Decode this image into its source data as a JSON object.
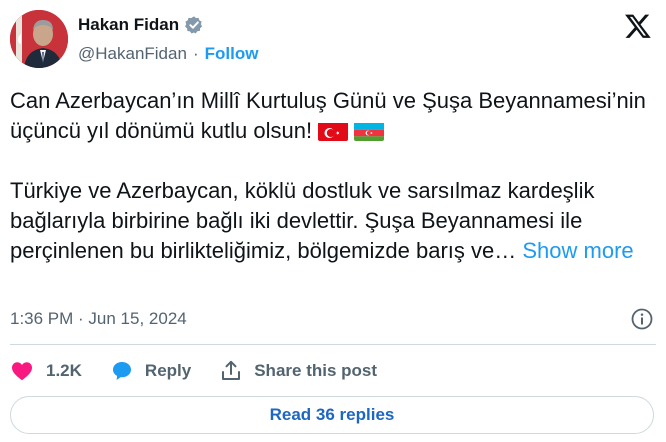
{
  "author": {
    "display_name": "Hakan Fidan",
    "handle": "@HakanFidan",
    "separator": "·",
    "follow_label": "Follow",
    "verified": true
  },
  "tweet": {
    "paragraph1": "Can Azerbaycan’ın Millî Kurtuluş Günü ve Şuşa Beyannamesi’nin üçüncü yıl dönümü kutlu olsun!",
    "paragraph2": "Türkiye ve Azerbaycan, köklü dostluk ve sarsılmaz kardeşlik bağlarıyla birbirine bağlı iki devlettir. Şuşa Beyannamesi ile perçinlenen bu birlikteliğimiz, bölgemizde barış ve…",
    "show_more_label": "Show more",
    "flags": [
      "turkey-flag-icon",
      "azerbaijan-flag-icon"
    ]
  },
  "meta": {
    "timestamp": "1:36 PM · Jun 15, 2024"
  },
  "actions": {
    "like_count": "1.2K",
    "reply_label": "Reply",
    "share_label": "Share this post"
  },
  "replies_button_label": "Read 36 replies",
  "colors": {
    "accent": "#1d9bf0",
    "like": "#f91880",
    "text": "#0f1419",
    "muted": "#536471",
    "border": "#cfd9de"
  }
}
